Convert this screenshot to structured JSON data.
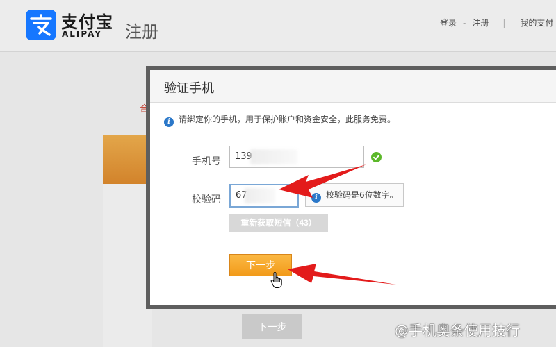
{
  "header": {
    "logo_cn": "支付宝",
    "logo_en": "ALIPAY",
    "page_title": "注册",
    "nav": {
      "login": "登录",
      "separator": "-",
      "register": "注册",
      "divider": "|",
      "my_alipay": "我的支付"
    }
  },
  "background": {
    "hint_char": "合",
    "next_label": "下一步"
  },
  "dialog": {
    "title": "验证手机",
    "notice": "请绑定你的手机，用于保护账户和资金安全，此服务免费。",
    "phone_label": "手机号",
    "phone_value": "139",
    "code_label": "校验码",
    "code_value": "67",
    "code_tip": "校验码是6位数字。",
    "resend_label": "重新获取短信（43）",
    "next_label": "下一步"
  },
  "watermark": "@手机奥条使用技行",
  "colors": {
    "alipay_blue": "#1677ff",
    "primary_orange": "#f29b1a",
    "success_green": "#5cb82a",
    "info_blue": "#2b78c9",
    "annotation_red": "#e31b1b"
  },
  "icons": {
    "logo": "alipay-logo-icon",
    "info": "info-icon",
    "valid": "check-circle-icon",
    "cursor": "hand-pointer-icon"
  }
}
